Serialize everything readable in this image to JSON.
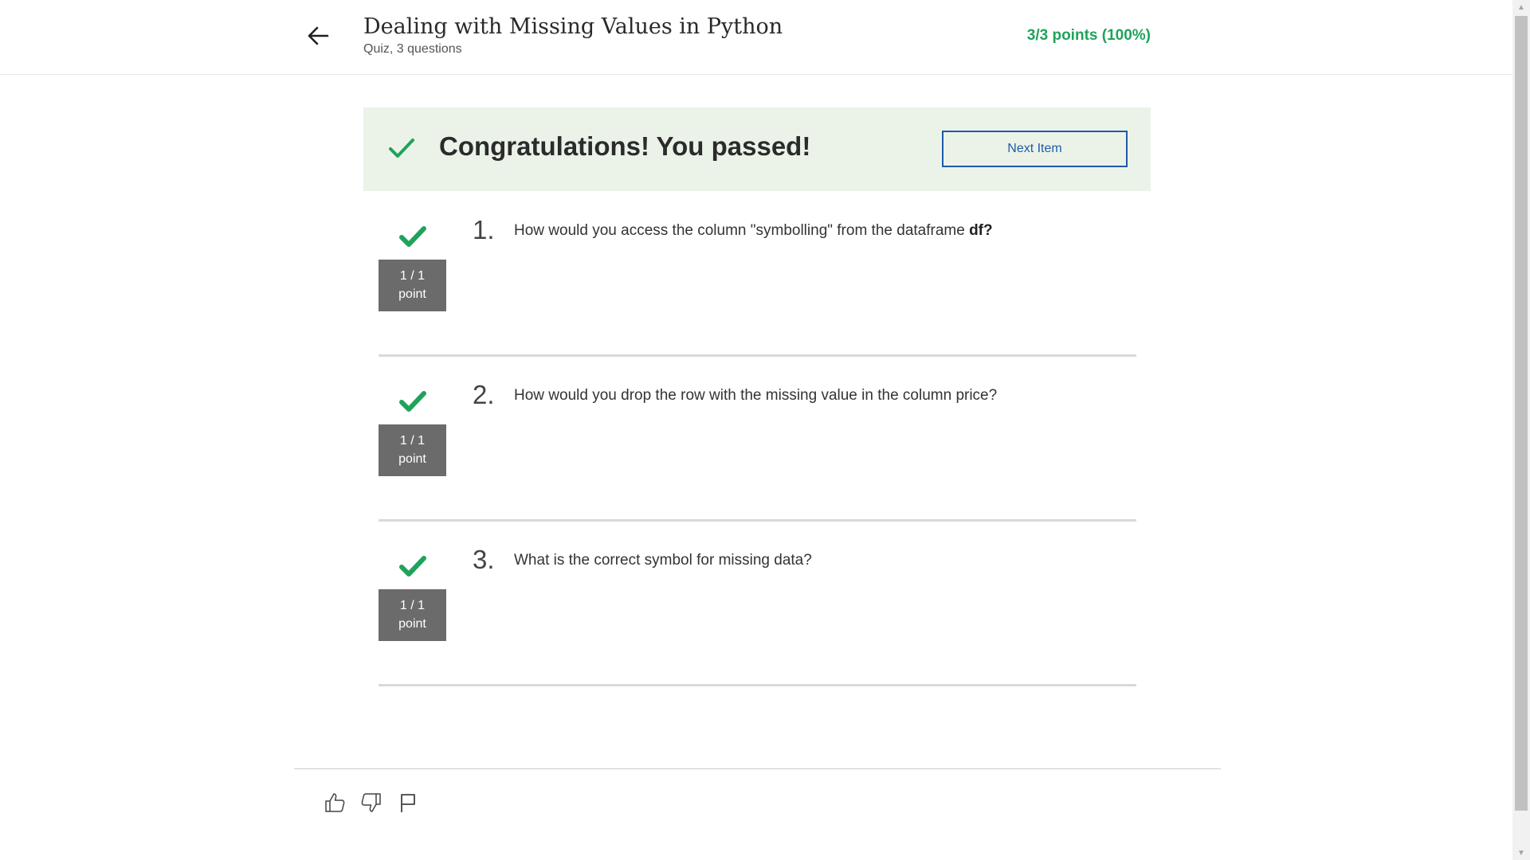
{
  "header": {
    "title": "Dealing with Missing Values in Python",
    "subtitle": "Quiz, 3 questions",
    "score": "3/3 points (100%)"
  },
  "banner": {
    "message": "Congratulations! You passed!",
    "next_button": "Next Item"
  },
  "questions": [
    {
      "number": "1.",
      "text": "How would you access the column \"symbolling\" from the dataframe ",
      "text_bold": "df?",
      "points_top": "1 / 1",
      "points_bottom": "point"
    },
    {
      "number": "2.",
      "text": "How would you drop the row with the missing value in the column price?",
      "text_bold": "",
      "points_top": "1 / 1",
      "points_bottom": "point"
    },
    {
      "number": "3.",
      "text": "What is the correct symbol for missing data?",
      "text_bold": "",
      "points_top": "1 / 1",
      "points_bottom": "point"
    }
  ],
  "footer": {
    "icons": [
      "thumbs-up-icon",
      "thumbs-down-icon",
      "flag-icon"
    ]
  },
  "colors": {
    "success_green": "#1fa35a",
    "banner_bg": "#ebf3e9",
    "link_blue": "#1f5aa8",
    "points_box": "#6b6b6b"
  }
}
